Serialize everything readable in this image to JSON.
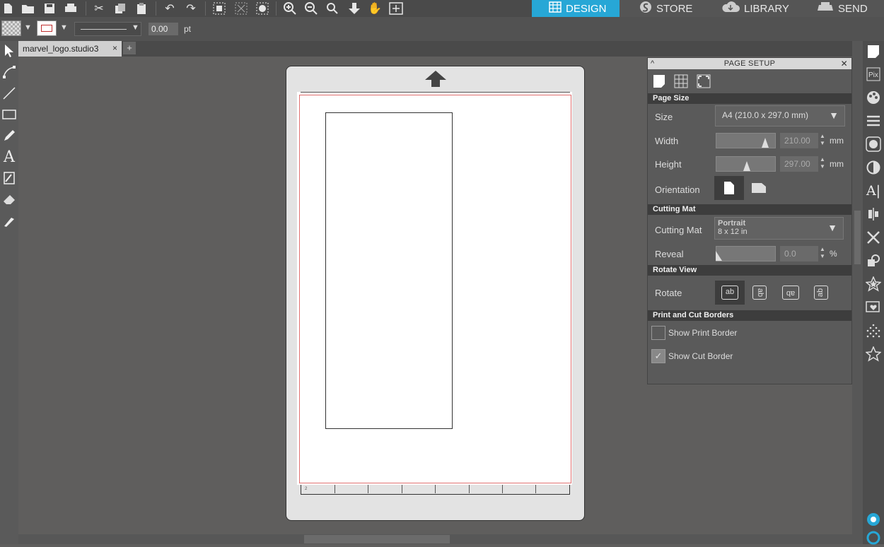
{
  "nav_tabs": [
    {
      "label": "DESIGN",
      "icon": "design-grid-icon",
      "active": true
    },
    {
      "label": "STORE",
      "icon": "store-s-icon",
      "active": false
    },
    {
      "label": "LIBRARY",
      "icon": "cloud-icon",
      "active": false
    },
    {
      "label": "SEND",
      "icon": "printer-send-icon",
      "active": false
    }
  ],
  "toolbar": {
    "line_width": "0.00",
    "line_unit": "pt"
  },
  "document_tab": {
    "name": "marvel_logo.studio3",
    "close": "×",
    "add": "+"
  },
  "panel": {
    "title": "PAGE SETUP",
    "page_size": {
      "section": "Page Size",
      "size_label": "Size",
      "size_value": "A4 (210.0 x 297.0 mm)",
      "width_label": "Width",
      "width_value": "210.00",
      "height_label": "Height",
      "height_value": "297.00",
      "unit": "mm",
      "orientation_label": "Orientation"
    },
    "cutting_mat": {
      "section": "Cutting Mat",
      "mat_label": "Cutting Mat",
      "mat_line1": "Portrait",
      "mat_line2": "8 x 12 in",
      "reveal_label": "Reveal",
      "reveal_value": "0.0",
      "reveal_unit": "%"
    },
    "rotate_view": {
      "section": "Rotate View",
      "rotate_label": "Rotate",
      "options": [
        "ab",
        "ab",
        "ab",
        "ab"
      ]
    },
    "borders": {
      "section": "Print and Cut Borders",
      "print_border_label": "Show Print Border",
      "print_border_checked": false,
      "cut_border_label": "Show Cut Border",
      "cut_border_checked": true
    }
  },
  "ruler": {
    "label": "2"
  },
  "colors": {
    "accent": "#27a7d6",
    "cut_border": "#e07070",
    "panel_bg": "#5a5a5a",
    "canvas_bg": "#5f5e5d"
  }
}
